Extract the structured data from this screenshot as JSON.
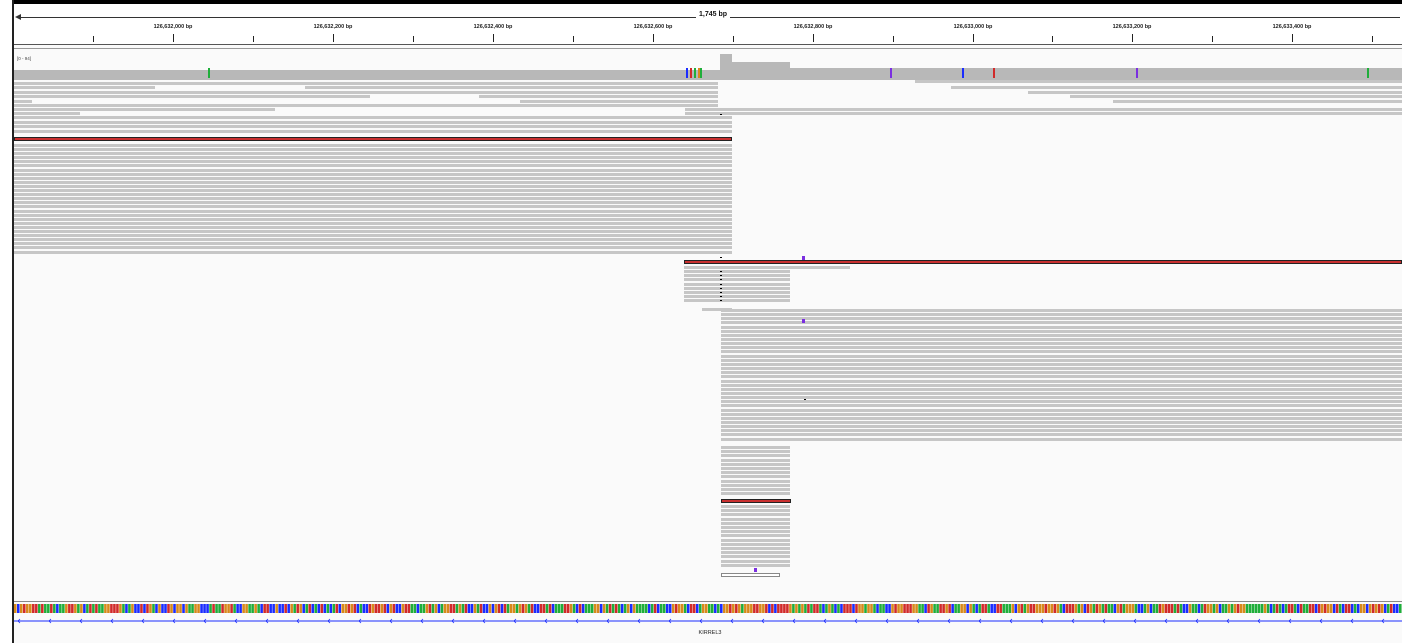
{
  "ruler": {
    "span_label": "1,745 bp",
    "ticks": [
      {
        "label": "126,632,000 bp"
      },
      {
        "label": "126,632,200 bp"
      },
      {
        "label": "126,632,400 bp"
      },
      {
        "label": "126,632,600 bp"
      },
      {
        "label": "126,632,800 bp"
      },
      {
        "label": "126,633,000 bp"
      },
      {
        "label": "126,633,200 bp"
      },
      {
        "label": "126,633,400 bp"
      }
    ]
  },
  "coverage": {
    "range_label": "[0 - 94]",
    "bar_color": "#b8b8b8"
  },
  "gene": {
    "name": "KIRREL3",
    "strand_color": "#1a2cff"
  },
  "colors": {
    "read": "#c6c6c6",
    "read_highlight": "#c93030",
    "insertion": "#7b2fe0",
    "A": "#1fae3a",
    "C": "#1a2cff",
    "G": "#d7891b",
    "T": "#d12a2a"
  }
}
